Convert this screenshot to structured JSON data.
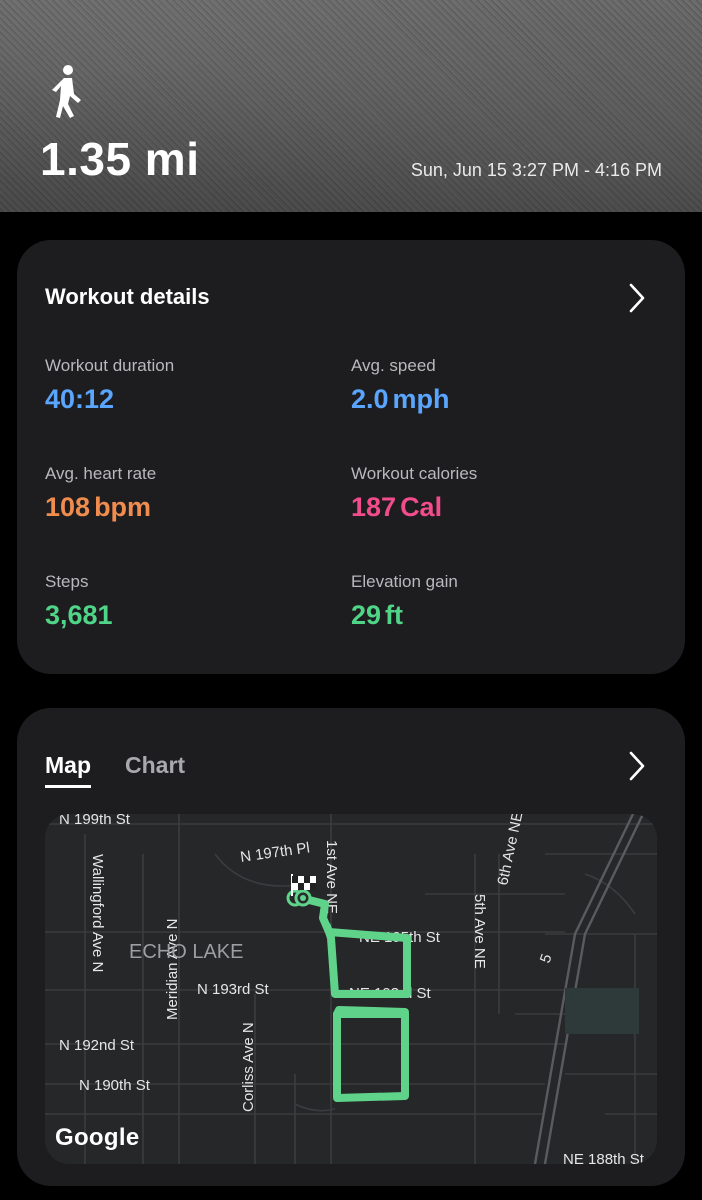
{
  "header": {
    "activity_icon": "walking-person-icon",
    "distance": "1.35 mi",
    "time_range": "Sun, Jun 15 3:27 PM - 4:16 PM"
  },
  "workout_details": {
    "title": "Workout details",
    "metrics": [
      {
        "label": "Workout duration",
        "value": "40:12",
        "unit": "",
        "color": "#5aa6ff"
      },
      {
        "label": "Avg. speed",
        "value": "2.0",
        "unit": "mph",
        "color": "#5aa6ff"
      },
      {
        "label": "Avg. heart rate",
        "value": "108",
        "unit": "bpm",
        "color": "#f08c4e"
      },
      {
        "label": "Workout calories",
        "value": "187",
        "unit": "Cal",
        "color": "#f24c8c"
      },
      {
        "label": "Steps",
        "value": "3,681",
        "unit": "",
        "color": "#4fd488"
      },
      {
        "label": "Elevation gain",
        "value": "29",
        "unit": "ft",
        "color": "#4fd488"
      }
    ]
  },
  "map_section": {
    "tabs": [
      {
        "label": "Map",
        "active": true
      },
      {
        "label": "Chart",
        "active": false
      }
    ],
    "area_label": "ECHO LAKE",
    "street_labels": {
      "n199": "N 199th St",
      "n197pl": "N 197th Pl",
      "wallingford": "Wallingford Ave N",
      "ave1": "1st Ave NE",
      "ave6": "6th Ave NE",
      "ave5": "5th Ave NE",
      "ne195": "NE 195th St",
      "n193": "N 193rd St",
      "ne193": "NE 193rd St",
      "n192": "N 192nd St",
      "meridian": "Meridian Ave N",
      "corliss": "Corliss Ave N",
      "n190": "N 190th St",
      "ne188": "NE 188th St",
      "hwy": "5"
    },
    "attribution": "Google",
    "route_color": "#5fd38a"
  }
}
